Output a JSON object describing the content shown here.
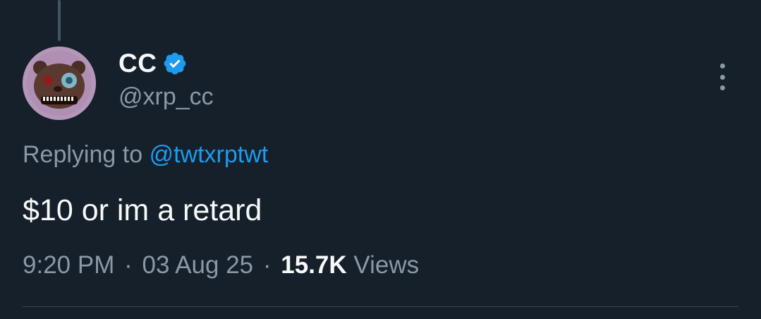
{
  "tweet": {
    "display_name": "CC",
    "handle": "@xrp_cc",
    "replying_prefix": "Replying to",
    "replying_to": "@twtxrptwt",
    "text": "$10 or im a retard",
    "time": "9:20 PM",
    "date": "03 Aug 25",
    "separator": "·",
    "views_count": "15.7K",
    "views_label": "Views"
  },
  "icons": {
    "verified": "verified-badge-icon",
    "more": "more-vertical-icon"
  },
  "colors": {
    "background": "#15202b",
    "primary_text": "#f7f9f9",
    "secondary_text": "#8b98a5",
    "accent": "#1d9bf0",
    "divider": "#38444d"
  }
}
